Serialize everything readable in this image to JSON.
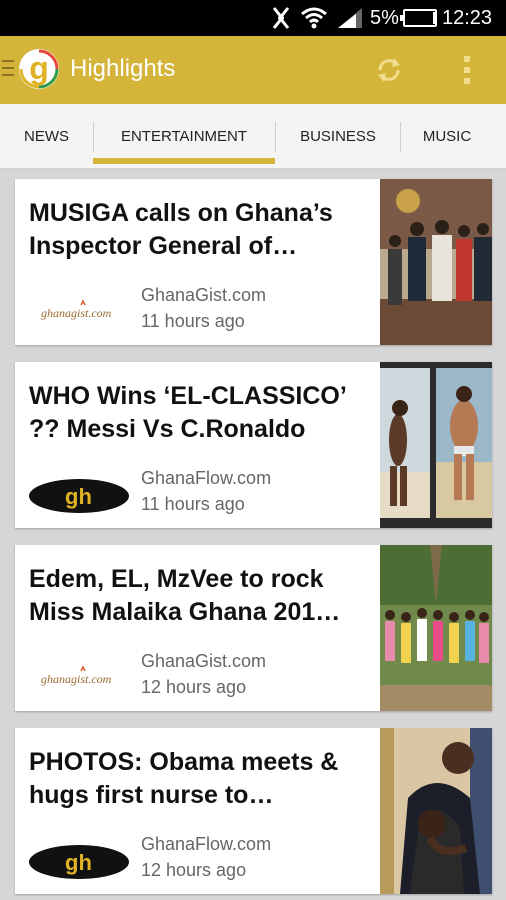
{
  "statusbar": {
    "battery": "5%",
    "time": "12:23"
  },
  "appbar": {
    "title": "Highlights",
    "logo_letter": "g"
  },
  "tabs": [
    {
      "label": "NEWS"
    },
    {
      "label": "ENTERTAINMENT",
      "selected": true
    },
    {
      "label": "BUSINESS"
    },
    {
      "label": "MUSIC"
    }
  ],
  "colors": {
    "accent": "#d4b53a",
    "statusbar": "#000000",
    "card": "#ffffff",
    "background": "#d6d6d6"
  },
  "articles": [
    {
      "title": "MUSIGA calls on Ghana’s Inspector General of…",
      "source": "GhanaGist.com",
      "time": "11 hours ago",
      "logo_text": "ghanagist.com",
      "logo_icon": "ghanagist-logo"
    },
    {
      "title": "WHO Wins ‘EL-CLASSICO’ ?? Messi Vs C.Ronaldo",
      "source": "GhanaFlow.com",
      "time": "11 hours ago",
      "logo_text": "gh",
      "logo_icon": "ghanaflow-logo"
    },
    {
      "title": "Edem, EL, MzVee to rock Miss Malaika Ghana 201…",
      "source": "GhanaGist.com",
      "time": "12 hours ago",
      "logo_text": "ghanagist.com",
      "logo_icon": "ghanagist-logo"
    },
    {
      "title": "PHOTOS:  Obama meets & hugs first nurse to…",
      "source": "GhanaFlow.com",
      "time": "12 hours ago",
      "logo_text": "gh",
      "logo_icon": "ghanaflow-logo"
    }
  ]
}
